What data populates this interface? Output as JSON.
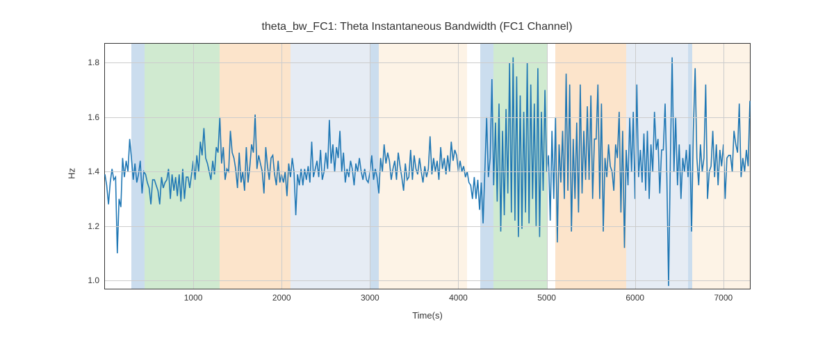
{
  "chart_data": {
    "type": "line",
    "title": "theta_bw_FC1: Theta Instantaneous Bandwidth (FC1 Channel)",
    "xlabel": "Time(s)",
    "ylabel": "Hz",
    "xlim": [
      0,
      7300
    ],
    "ylim": [
      0.97,
      1.87
    ],
    "xticks": [
      1000,
      2000,
      3000,
      4000,
      5000,
      6000,
      7000
    ],
    "yticks": [
      1.0,
      1.2,
      1.4,
      1.6,
      1.8
    ],
    "bands": [
      {
        "x0": 300,
        "x1": 450,
        "color": "#6a9fcf"
      },
      {
        "x0": 450,
        "x1": 1300,
        "color": "#77c277"
      },
      {
        "x0": 1300,
        "x1": 2100,
        "color": "#f6b26b"
      },
      {
        "x0": 2100,
        "x1": 3000,
        "color": "#b8c9e0"
      },
      {
        "x0": 3000,
        "x1": 3100,
        "color": "#6a9fcf"
      },
      {
        "x0": 3100,
        "x1": 4100,
        "color": "#f8dcb8"
      },
      {
        "x0": 4100,
        "x1": 4250,
        "color": "#ffffff"
      },
      {
        "x0": 4250,
        "x1": 4400,
        "color": "#6a9fcf"
      },
      {
        "x0": 4400,
        "x1": 5000,
        "color": "#77c277"
      },
      {
        "x0": 5000,
        "x1": 5100,
        "color": "#ffffff"
      },
      {
        "x0": 5100,
        "x1": 5900,
        "color": "#f6b26b"
      },
      {
        "x0": 5900,
        "x1": 6600,
        "color": "#b8c9e0"
      },
      {
        "x0": 6600,
        "x1": 6650,
        "color": "#6a9fcf"
      },
      {
        "x0": 6650,
        "x1": 7300,
        "color": "#f8dcb8"
      }
    ],
    "line_color": "#1f77b4",
    "x": [
      0,
      20,
      40,
      60,
      80,
      100,
      120,
      140,
      160,
      180,
      200,
      220,
      240,
      260,
      280,
      300,
      320,
      340,
      360,
      380,
      400,
      420,
      440,
      460,
      480,
      500,
      520,
      540,
      560,
      580,
      600,
      620,
      640,
      660,
      680,
      700,
      720,
      740,
      760,
      780,
      800,
      820,
      840,
      860,
      880,
      900,
      920,
      940,
      960,
      980,
      1000,
      1020,
      1040,
      1060,
      1080,
      1100,
      1120,
      1140,
      1160,
      1180,
      1200,
      1220,
      1240,
      1260,
      1280,
      1300,
      1320,
      1340,
      1360,
      1380,
      1400,
      1420,
      1440,
      1460,
      1480,
      1500,
      1520,
      1540,
      1560,
      1580,
      1600,
      1620,
      1640,
      1660,
      1680,
      1700,
      1720,
      1740,
      1760,
      1780,
      1800,
      1820,
      1840,
      1860,
      1880,
      1900,
      1920,
      1940,
      1960,
      1980,
      2000,
      2020,
      2040,
      2060,
      2080,
      2100,
      2120,
      2140,
      2160,
      2180,
      2200,
      2220,
      2240,
      2260,
      2280,
      2300,
      2320,
      2340,
      2360,
      2380,
      2400,
      2420,
      2440,
      2460,
      2480,
      2500,
      2520,
      2540,
      2560,
      2580,
      2600,
      2620,
      2640,
      2660,
      2680,
      2700,
      2720,
      2740,
      2760,
      2780,
      2800,
      2820,
      2840,
      2860,
      2880,
      2900,
      2920,
      2940,
      2960,
      2980,
      3000,
      3020,
      3040,
      3060,
      3080,
      3100,
      3120,
      3140,
      3160,
      3180,
      3200,
      3220,
      3240,
      3260,
      3280,
      3300,
      3320,
      3340,
      3360,
      3380,
      3400,
      3420,
      3440,
      3460,
      3480,
      3500,
      3520,
      3540,
      3560,
      3580,
      3600,
      3620,
      3640,
      3660,
      3680,
      3700,
      3720,
      3740,
      3760,
      3780,
      3800,
      3820,
      3840,
      3860,
      3880,
      3900,
      3920,
      3940,
      3960,
      3980,
      4000,
      4020,
      4040,
      4060,
      4080,
      4100,
      4120,
      4140,
      4160,
      4180,
      4200,
      4220,
      4240,
      4260,
      4280,
      4300,
      4320,
      4340,
      4360,
      4380,
      4400,
      4420,
      4440,
      4460,
      4480,
      4500,
      4520,
      4540,
      4560,
      4580,
      4600,
      4620,
      4640,
      4660,
      4680,
      4700,
      4720,
      4740,
      4760,
      4780,
      4800,
      4820,
      4840,
      4860,
      4880,
      4900,
      4920,
      4940,
      4960,
      4980,
      5000,
      5020,
      5040,
      5060,
      5080,
      5100,
      5120,
      5140,
      5160,
      5180,
      5200,
      5220,
      5240,
      5260,
      5280,
      5300,
      5320,
      5340,
      5360,
      5380,
      5400,
      5420,
      5440,
      5460,
      5480,
      5500,
      5520,
      5540,
      5560,
      5580,
      5600,
      5620,
      5640,
      5660,
      5680,
      5700,
      5720,
      5740,
      5760,
      5780,
      5800,
      5820,
      5840,
      5860,
      5880,
      5900,
      5920,
      5940,
      5960,
      5980,
      6000,
      6020,
      6040,
      6060,
      6080,
      6100,
      6120,
      6140,
      6160,
      6180,
      6200,
      6220,
      6240,
      6260,
      6280,
      6300,
      6320,
      6340,
      6360,
      6380,
      6400,
      6420,
      6440,
      6460,
      6480,
      6500,
      6520,
      6540,
      6560,
      6580,
      6600,
      6620,
      6640,
      6660,
      6680,
      6700,
      6720,
      6740,
      6760,
      6780,
      6800,
      6820,
      6840,
      6860,
      6880,
      6900,
      6920,
      6940,
      6960,
      6980,
      7000,
      7020,
      7040,
      7060,
      7080,
      7100,
      7120,
      7140,
      7160,
      7180,
      7200,
      7220,
      7240,
      7260,
      7280,
      7300
    ],
    "y": [
      1.39,
      1.35,
      1.28,
      1.36,
      1.41,
      1.37,
      1.38,
      1.1,
      1.3,
      1.27,
      1.45,
      1.38,
      1.44,
      1.4,
      1.52,
      1.45,
      1.37,
      1.43,
      1.36,
      1.39,
      1.44,
      1.32,
      1.4,
      1.39,
      1.36,
      1.34,
      1.28,
      1.37,
      1.37,
      1.35,
      1.33,
      1.28,
      1.38,
      1.34,
      1.36,
      1.37,
      1.41,
      1.3,
      1.39,
      1.33,
      1.38,
      1.31,
      1.39,
      1.29,
      1.41,
      1.3,
      1.38,
      1.38,
      1.34,
      1.39,
      1.44,
      1.37,
      1.46,
      1.4,
      1.51,
      1.46,
      1.56,
      1.45,
      1.43,
      1.4,
      1.37,
      1.44,
      1.39,
      1.49,
      1.47,
      1.6,
      1.43,
      1.49,
      1.37,
      1.41,
      1.4,
      1.55,
      1.47,
      1.45,
      1.41,
      1.34,
      1.47,
      1.36,
      1.4,
      1.33,
      1.49,
      1.36,
      1.42,
      1.5,
      1.47,
      1.61,
      1.41,
      1.46,
      1.43,
      1.4,
      1.32,
      1.49,
      1.42,
      1.37,
      1.45,
      1.46,
      1.39,
      1.35,
      1.44,
      1.36,
      1.39,
      1.36,
      1.4,
      1.31,
      1.43,
      1.38,
      1.45,
      1.4,
      1.24,
      1.39,
      1.35,
      1.41,
      1.35,
      1.41,
      1.37,
      1.42,
      1.36,
      1.51,
      1.38,
      1.41,
      1.44,
      1.38,
      1.48,
      1.37,
      1.4,
      1.47,
      1.41,
      1.59,
      1.43,
      1.5,
      1.4,
      1.49,
      1.45,
      1.55,
      1.4,
      1.47,
      1.36,
      1.41,
      1.38,
      1.44,
      1.41,
      1.35,
      1.43,
      1.4,
      1.45,
      1.4,
      1.37,
      1.41,
      1.37,
      1.36,
      1.4,
      1.46,
      1.37,
      1.41,
      1.38,
      1.32,
      1.45,
      1.4,
      1.5,
      1.43,
      1.47,
      1.44,
      1.37,
      1.41,
      1.44,
      1.37,
      1.47,
      1.42,
      1.38,
      1.33,
      1.43,
      1.37,
      1.38,
      1.48,
      1.37,
      1.46,
      1.41,
      1.39,
      1.45,
      1.4,
      1.36,
      1.42,
      1.38,
      1.41,
      1.53,
      1.39,
      1.45,
      1.4,
      1.44,
      1.37,
      1.49,
      1.41,
      1.45,
      1.39,
      1.46,
      1.4,
      1.51,
      1.44,
      1.48,
      1.46,
      1.4,
      1.44,
      1.4,
      1.42,
      1.38,
      1.4,
      1.36,
      1.35,
      1.3,
      1.38,
      1.3,
      1.37,
      1.26,
      1.36,
      1.21,
      1.4,
      1.6,
      1.38,
      1.45,
      1.74,
      1.35,
      1.58,
      1.29,
      1.65,
      1.18,
      1.55,
      1.24,
      1.63,
      1.32,
      1.8,
      1.25,
      1.82,
      1.22,
      1.75,
      1.16,
      1.68,
      1.19,
      1.62,
      1.25,
      1.8,
      1.21,
      1.72,
      1.3,
      1.65,
      1.2,
      1.78,
      1.16,
      1.62,
      1.33,
      1.7,
      1.4,
      1.46,
      1.22,
      1.55,
      1.3,
      1.6,
      1.14,
      1.5,
      1.36,
      1.55,
      1.3,
      1.76,
      1.33,
      1.72,
      1.18,
      1.52,
      1.3,
      1.58,
      1.25,
      1.72,
      1.32,
      1.55,
      1.37,
      1.64,
      1.37,
      1.68,
      1.3,
      1.52,
      1.52,
      1.72,
      1.3,
      1.65,
      1.18,
      1.45,
      1.38,
      1.5,
      1.42,
      1.4,
      1.33,
      1.5,
      1.45,
      1.62,
      1.25,
      1.55,
      1.12,
      1.48,
      1.35,
      1.6,
      1.4,
      1.62,
      1.3,
      1.72,
      1.38,
      1.48,
      1.36,
      1.54,
      1.33,
      1.55,
      1.3,
      1.5,
      1.4,
      1.62,
      1.48,
      1.52,
      1.32,
      1.48,
      1.48,
      1.65,
      1.38,
      0.98,
      1.45,
      1.82,
      1.4,
      1.6,
      1.35,
      1.5,
      1.3,
      1.45,
      1.4,
      1.48,
      1.38,
      1.5,
      1.18,
      1.55,
      1.78,
      1.45,
      1.35,
      1.5,
      1.4,
      1.45,
      1.72,
      1.3,
      1.4,
      1.42,
      1.55,
      1.38,
      1.5,
      1.35,
      1.48,
      1.42,
      1.5,
      1.3,
      1.45,
      1.46,
      1.46,
      1.4,
      1.55,
      1.5,
      1.47,
      1.65,
      1.38,
      1.45,
      1.4,
      1.48,
      1.42,
      1.66
    ]
  }
}
